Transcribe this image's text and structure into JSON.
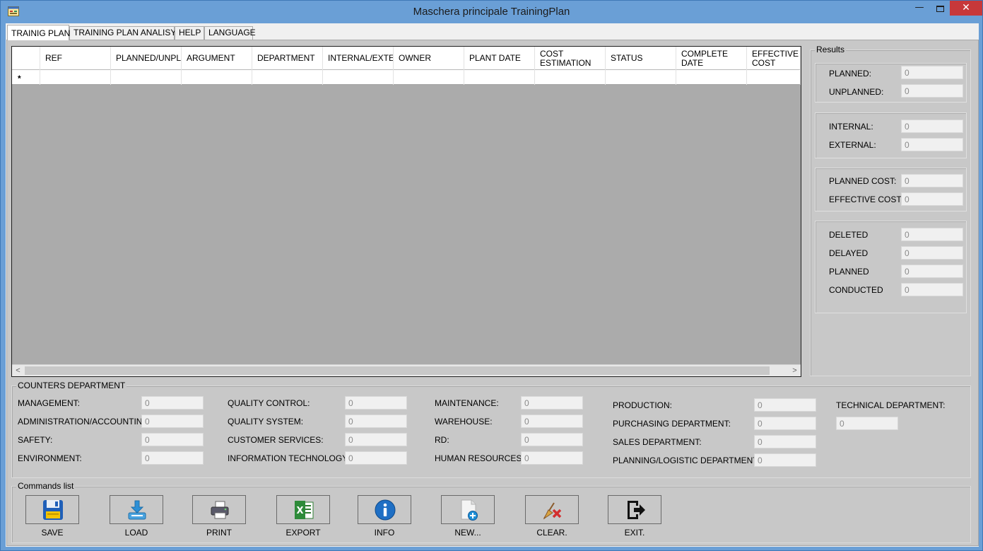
{
  "window": {
    "title": "Maschera principale TrainingPlan",
    "minimize": "—",
    "close": "✕"
  },
  "tabs": [
    "TRAINIG PLAN",
    "TRAINING PLAN ANALISYS",
    "HELP",
    "LANGUAGE"
  ],
  "grid": {
    "columns": [
      "REF",
      "PLANNED/UNPLANNED",
      "ARGUMENT",
      "DEPARTMENT",
      "INTERNAL/EXTERNAL",
      "OWNER",
      "PLANT DATE",
      "COST ESTIMATION",
      "STATUS",
      "COMPLETE DATE",
      "EFFECTIVE COST"
    ],
    "new_row_marker": "*",
    "scroll_left": "<",
    "scroll_right": ">"
  },
  "results": {
    "title": "Results",
    "planned_label": "PLANNED:",
    "planned_value": "0",
    "unplanned_label": "UNPLANNED:",
    "unplanned_value": "0",
    "internal_label": "INTERNAL:",
    "internal_value": "0",
    "external_label": "EXTERNAL:",
    "external_value": "0",
    "planned_cost_label": "PLANNED COST:",
    "planned_cost_value": "0",
    "effective_cost_label": "EFFECTIVE COST:",
    "effective_cost_value": "0",
    "deleted_label": "DELETED",
    "deleted_value": "0",
    "delayed_label": "DELAYED",
    "delayed_value": "0",
    "status_planned_label": "PLANNED",
    "status_planned_value": "0",
    "conducted_label": "CONDUCTED",
    "conducted_value": "0"
  },
  "counters": {
    "title": "COUNTERS DEPARTMENT",
    "management_label": "MANAGEMENT:",
    "management_value": "0",
    "administration_label": "ADMINISTRATION/ACCOUNTING:",
    "administration_value": "0",
    "safety_label": "SAFETY:",
    "safety_value": "0",
    "environment_label": "ENVIRONMENT:",
    "environment_value": "0",
    "quality_control_label": "QUALITY CONTROL:",
    "quality_control_value": "0",
    "quality_system_label": "QUALITY SYSTEM:",
    "quality_system_value": "0",
    "customer_services_label": "CUSTOMER SERVICES:",
    "customer_services_value": "0",
    "information_technology_label": "INFORMATION TECHNOLOGY:",
    "information_technology_value": "0",
    "maintenance_label": "MAINTENANCE:",
    "maintenance_value": "0",
    "warehouse_label": "WAREHOUSE:",
    "warehouse_value": "0",
    "rd_label": "RD:",
    "rd_value": "0",
    "human_resources_label": "HUMAN RESOURCES:",
    "human_resources_value": "0",
    "production_label": "PRODUCTION:",
    "production_value": "0",
    "purchasing_label": "PURCHASING DEPARTMENT:",
    "purchasing_value": "0",
    "sales_label": "SALES DEPARTMENT:",
    "sales_value": "0",
    "planning_label": "PLANNING/LOGISTIC DEPARTMENT:",
    "planning_value": "0",
    "technical_label": "TECHNICAL DEPARTMENT:",
    "technical_value": "0"
  },
  "commands": {
    "title": "Commands list",
    "save": "SAVE",
    "load": "LOAD",
    "print": "PRINT",
    "export": "EXPORT",
    "info": "INFO",
    "new": "NEW...",
    "clear": "CLEAR.",
    "exit": "EXIT."
  },
  "icons": {
    "app": "app-form-icon",
    "save": "floppy-disk-icon",
    "load": "download-tray-icon",
    "print": "printer-icon",
    "export": "excel-icon",
    "info": "info-icon",
    "new": "new-document-icon",
    "clear": "broom-clear-icon",
    "exit": "exit-door-icon"
  },
  "colors": {
    "titlebar": "#6a9fd6",
    "close_button": "#c7383a",
    "tab_page": "#c8c8c8",
    "grid_background": "#ababab"
  }
}
